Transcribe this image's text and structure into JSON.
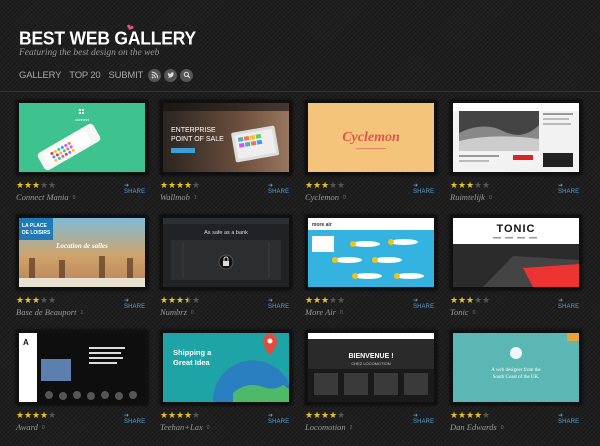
{
  "site": {
    "title": "BEST WEB GALLERY",
    "tagline": "Featuring the best design on the web"
  },
  "nav": {
    "links": [
      "GALLERY",
      "TOP 20",
      "SUBMIT"
    ],
    "icons": [
      "rss-icon",
      "twitter-icon",
      "search-icon"
    ]
  },
  "colors": {
    "background": "#1f1f1f",
    "star": "#e5c12a",
    "share": "#5a9fd4",
    "logo_heart": "#e84d7a"
  },
  "share_label": "SHARE",
  "sites": [
    {
      "name": "Connect Mania",
      "rating": 3,
      "count": "0"
    },
    {
      "name": "Wallmob",
      "rating": 4,
      "count": "1"
    },
    {
      "name": "Cyclemon",
      "rating": 3,
      "count": "0"
    },
    {
      "name": "Ruimtelijk",
      "rating": 3,
      "count": "0"
    },
    {
      "name": "Base de Beauport",
      "rating": 3,
      "count": "1"
    },
    {
      "name": "Numbrz",
      "rating": 3.5,
      "count": "0"
    },
    {
      "name": "More Air",
      "rating": 3,
      "count": "0"
    },
    {
      "name": "Tonic",
      "rating": 3,
      "count": "0"
    },
    {
      "name": "Award",
      "rating": 4,
      "count": "0"
    },
    {
      "name": "Teehan+Lax",
      "rating": 4,
      "count": "0"
    },
    {
      "name": "Locomotion",
      "rating": 4,
      "count": "2"
    },
    {
      "name": "Dan Edwards",
      "rating": 4,
      "count": "0"
    }
  ],
  "thumbnail_texts": {
    "connect": "connect",
    "wallmob": [
      "ENTERPRISE",
      "POINT OF SALE"
    ],
    "cyclemon": "Cyclemon",
    "base": [
      "LA PLACE",
      "DE LOISIRS",
      "Location de salles"
    ],
    "numbrz": "As safe as a bank",
    "moreair": "more air",
    "tonic": "TONIC",
    "teehan": [
      "Shipping a",
      "Great Idea"
    ],
    "locomotion": [
      "BIENVENUE !",
      "CHEZ LOCOMOTION"
    ],
    "danedwards": [
      "A web designer from the",
      "South Coast of the UK."
    ]
  }
}
